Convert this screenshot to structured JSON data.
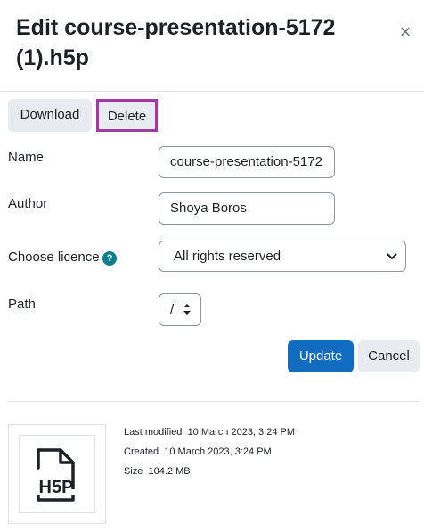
{
  "dialog": {
    "title": "Edit course-presentation-5172 (1).h5p",
    "close_label": "×"
  },
  "toolbar": {
    "download_label": "Download",
    "delete_label": "Delete"
  },
  "form": {
    "name_label": "Name",
    "name_value": "course-presentation-5172",
    "author_label": "Author",
    "author_value": "Shoya Boros",
    "licence_label": "Choose licence",
    "licence_help": "?",
    "licence_value": "All rights reserved",
    "path_label": "Path",
    "path_value": "/"
  },
  "actions": {
    "update_label": "Update",
    "cancel_label": "Cancel"
  },
  "file_info": {
    "last_modified_label": "Last modified",
    "last_modified_value": "10 March 2023, 3:24 PM",
    "created_label": "Created",
    "created_value": "10 March 2023, 3:24 PM",
    "size_label": "Size",
    "size_value": "104.2 MB",
    "icon": "h5p-file-icon"
  },
  "colors": {
    "primary": "#0f6cbf",
    "focus_outline": "#9b3e9f",
    "help_icon": "#0a7e8c"
  }
}
